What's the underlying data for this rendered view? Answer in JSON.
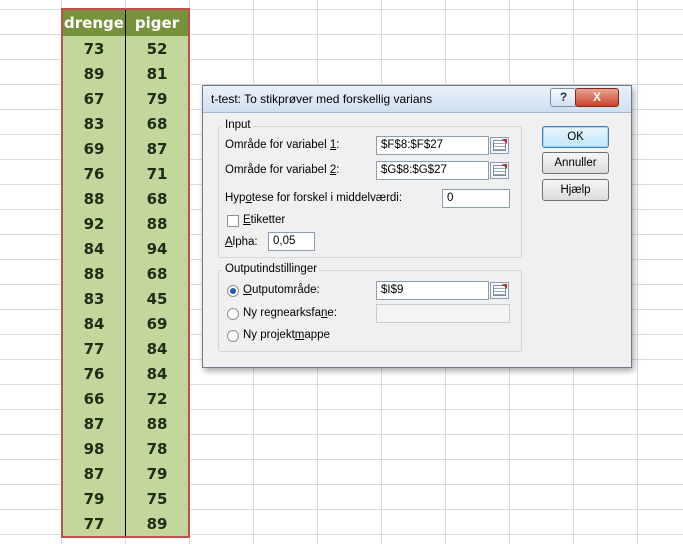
{
  "sheet": {
    "headers": [
      "drenge",
      "piger"
    ],
    "rows": [
      [
        "73",
        "52"
      ],
      [
        "89",
        "81"
      ],
      [
        "67",
        "79"
      ],
      [
        "83",
        "68"
      ],
      [
        "69",
        "87"
      ],
      [
        "76",
        "71"
      ],
      [
        "88",
        "68"
      ],
      [
        "92",
        "88"
      ],
      [
        "84",
        "94"
      ],
      [
        "88",
        "68"
      ],
      [
        "83",
        "45"
      ],
      [
        "84",
        "69"
      ],
      [
        "77",
        "84"
      ],
      [
        "76",
        "84"
      ],
      [
        "66",
        "72"
      ],
      [
        "87",
        "88"
      ],
      [
        "98",
        "78"
      ],
      [
        "87",
        "79"
      ],
      [
        "79",
        "75"
      ],
      [
        "77",
        "89"
      ]
    ]
  },
  "dialog": {
    "title": "t-test: To stikprøver med forskellig varians",
    "help_glyph": "?",
    "close_glyph": "X",
    "input": {
      "group_label": "Input",
      "var1_label_pre": "Område for variabel ",
      "var1_label_key": "1",
      "var1_label_post": ":",
      "var1_value": "$F$8:$F$27",
      "var2_label_pre": "Område for variabel ",
      "var2_label_key": "2",
      "var2_label_post": ":",
      "var2_value": "$G$8:$G$27",
      "hyp_label_pre": "Hyp",
      "hyp_label_key": "o",
      "hyp_label_post": "tese for forskel i middelværdi:",
      "hyp_value": "0",
      "labels_key": "E",
      "labels_rest": "tiketter",
      "labels_checked": false,
      "alpha_key": "A",
      "alpha_rest": "lpha:",
      "alpha_value": "0,05"
    },
    "output": {
      "group_label": "Outputindstillinger",
      "range_key": "O",
      "range_rest": "utputområde:",
      "range_value": "$I$9",
      "range_selected": true,
      "sheet_pre": "Ny regnearksfa",
      "sheet_key": "n",
      "sheet_post": "e:",
      "sheet_value": "",
      "book_pre": "Ny projekt",
      "book_key": "m",
      "book_post": "appe"
    },
    "buttons": {
      "ok": "OK",
      "cancel": "Annuller",
      "help_pre": "H",
      "help_key": "j",
      "help_post": "ælp"
    }
  }
}
